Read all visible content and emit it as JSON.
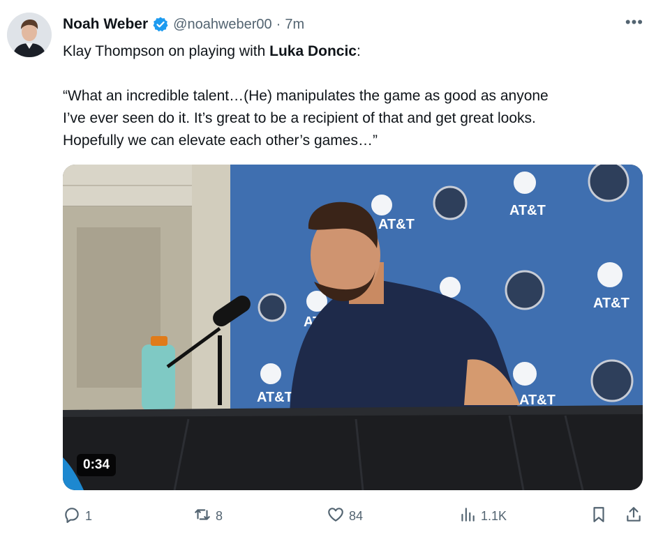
{
  "author": {
    "name": "Noah Weber",
    "handle": "@noahweber00",
    "separator": "·",
    "time": "7m",
    "verified_icon": "verified-badge-icon",
    "more_label": "•••"
  },
  "tweet": {
    "line1_prefix": "Klay Thompson on playing with ",
    "line1_bold": "Luka Doncic",
    "line1_suffix": ":",
    "quote_line1": "“What an incredible talent…(He) manipulates the game as good as anyone",
    "quote_line2": "I’ve ever seen do it. It’s great to be a recipient of that and get great looks.",
    "quote_line3": "Hopefully we can elevate each other’s games…”"
  },
  "media": {
    "type": "video",
    "duration": "0:34",
    "backdrop_text": "AT&T",
    "colors": {
      "backdrop": "#3f6fb0",
      "table": "#1c1d20",
      "shirt": "#1e2a4a"
    }
  },
  "actions": {
    "reply_count": "1",
    "retweet_count": "8",
    "like_count": "84",
    "views_count": "1.1K",
    "icons": [
      "reply-icon",
      "retweet-icon",
      "like-icon",
      "views-icon",
      "bookmark-icon",
      "share-icon"
    ]
  }
}
